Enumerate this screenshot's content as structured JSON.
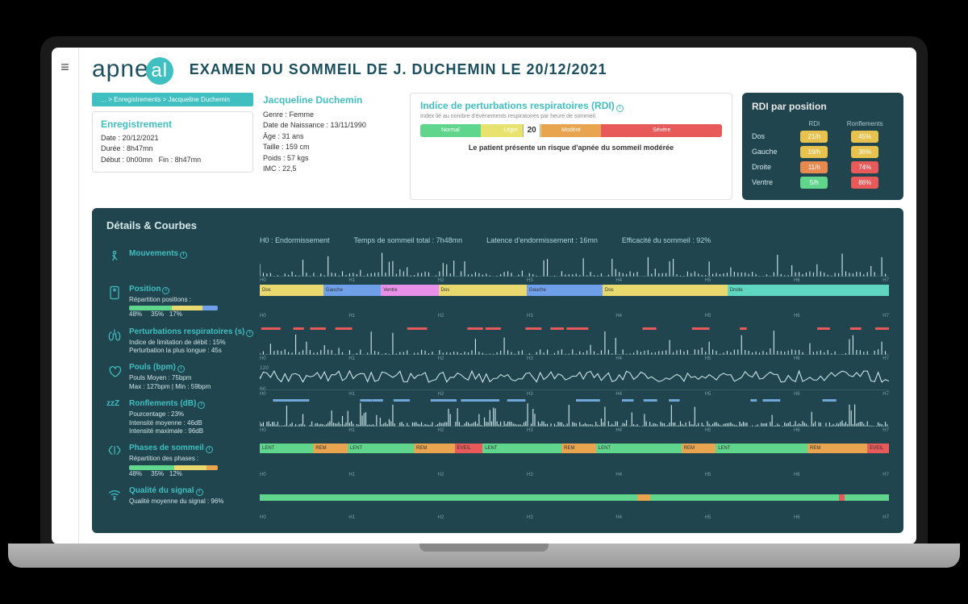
{
  "header": {
    "logo_left": "apne",
    "logo_right": "al",
    "title": "EXAMEN DU SOMMEIL DE J. DUCHEMIN LE 20/12/2021"
  },
  "breadcrumb": "… > Enregistrements > Jacqueline Duchemin",
  "recording": {
    "title": "Enregistrement",
    "date": "Date : 20/12/2021",
    "duration": "Durée : 8h47mn",
    "start": "Début : 0h00mn",
    "end": "Fin : 8h47mn"
  },
  "patient": {
    "name": "Jacqueline Duchemin",
    "gender": "Genre : Femme",
    "dob": "Date de Naissance : 13/11/1990",
    "age": "Âge : 31 ans",
    "height": "Taille : 159 cm",
    "weight": "Poids : 57 kgs",
    "bmi": "IMC : 22,5"
  },
  "rdi": {
    "title": "Indice de perturbations respiratoires (RDI)",
    "subtitle": "Index lié au nombre d'évènements respiratoires par heure de sommeil.",
    "levels": {
      "normal": "Normal",
      "leger": "Léger",
      "modere": "Modéré",
      "severe": "Sévère"
    },
    "value": "20",
    "risk": "Le patient présente un risque d'apnée du sommeil modérée"
  },
  "rdi_pos": {
    "title": "RDI par position",
    "h_rdi": "RDI",
    "h_ronf": "Ronflements",
    "rows": [
      {
        "label": "Dos",
        "rdi": "21/h",
        "ronf": "45%"
      },
      {
        "label": "Gauche",
        "rdi": "19/h",
        "ronf": "36%"
      },
      {
        "label": "Droite",
        "rdi": "11/h",
        "ronf": "74%"
      },
      {
        "label": "Ventre",
        "rdi": "5/h",
        "ronf": "86%"
      }
    ]
  },
  "details": {
    "title": "Détails & Courbes",
    "stats": {
      "h0": "H0 : Endormissement",
      "total": "Temps de sommeil total : 7h48mn",
      "latency": "Latence d'endormissement : 16mn",
      "eff": "Efficacité du sommeil : 92%"
    },
    "tracks": {
      "mouv": {
        "title": "Mouvements"
      },
      "pos": {
        "title": "Position",
        "rep": "Répartition positions :",
        "v1": "48%",
        "v2": "35%",
        "v3": "17%"
      },
      "pert": {
        "title": "Perturbations respiratoires (s)",
        "l1": "Indice de limitation de débit : 15%",
        "l2": "Perturbation la plus longue : 45s"
      },
      "pouls": {
        "title": "Pouls (bpm)",
        "l1": "Pouls Moyen : 75bpm",
        "l2": "Max : 127bpm | Min : 59bpm"
      },
      "ronf": {
        "title": "Ronflements (dB)",
        "l1": "Pourcentage : 23%",
        "l2": "Intensité moyenne : 46dB",
        "l3": "Intensité maximale : 96dB"
      },
      "phases": {
        "title": "Phases de sommeil",
        "rep": "Répartition des phases :",
        "v1": "48%",
        "v2": "35%",
        "v3": "12%"
      },
      "signal": {
        "title": "Qualité du signal",
        "l1": "Qualité moyenne du signal : 96%"
      }
    },
    "pos_segments": [
      {
        "label": "Dos",
        "color": "#e8d96f",
        "w": 10
      },
      {
        "label": "Gauche",
        "color": "#6f9fe8",
        "w": 9
      },
      {
        "label": "Ventre",
        "color": "#e88fe8",
        "w": 9
      },
      {
        "label": "Dos",
        "color": "#e8d96f",
        "w": 14
      },
      {
        "label": "Gauche",
        "color": "#6f9fe8",
        "w": 12
      },
      {
        "label": "Dos",
        "color": "#e8d96f",
        "w": 20
      },
      {
        "label": "Droite",
        "color": "#5fd6c0",
        "w": 26
      }
    ],
    "phase_segments": [
      {
        "label": "LENT",
        "color": "#5fd68b",
        "w": 8
      },
      {
        "label": "REM",
        "color": "#e8a44f",
        "w": 5
      },
      {
        "label": "LENT",
        "color": "#5fd68b",
        "w": 10
      },
      {
        "label": "REM",
        "color": "#e8a44f",
        "w": 6
      },
      {
        "label": "EVEIL",
        "color": "#e85a5a",
        "w": 4
      },
      {
        "label": "LENT",
        "color": "#5fd68b",
        "w": 12
      },
      {
        "label": "REM",
        "color": "#e8a44f",
        "w": 5
      },
      {
        "label": "LENT",
        "color": "#5fd68b",
        "w": 13
      },
      {
        "label": "REM",
        "color": "#e8a44f",
        "w": 5
      },
      {
        "label": "LENT",
        "color": "#5fd68b",
        "w": 14
      },
      {
        "label": "REM",
        "color": "#e8a44f",
        "w": 9
      },
      {
        "label": "EVEIL",
        "color": "#e85a5a",
        "w": 3
      }
    ],
    "hours": [
      "H0",
      "H1",
      "H2",
      "H3",
      "H4",
      "H5",
      "H6",
      "H7"
    ]
  },
  "chart_data": {
    "type": "table",
    "title": "RDI par position",
    "columns": [
      "Position",
      "RDI (/h)",
      "Ronflements (%)"
    ],
    "rows": [
      [
        "Dos",
        21,
        45
      ],
      [
        "Gauche",
        19,
        36
      ],
      [
        "Droite",
        11,
        74
      ],
      [
        "Ventre",
        5,
        86
      ]
    ]
  }
}
